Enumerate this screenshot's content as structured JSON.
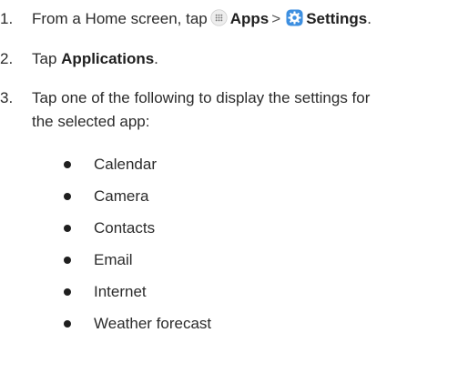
{
  "steps": [
    {
      "number": "1.",
      "prefix": "From a Home screen, tap",
      "apps_label": "Apps",
      "separator": ">",
      "settings_label": "Settings",
      "suffix": ".",
      "apps_icon": "apps-grid-icon",
      "settings_icon": "settings-gear-icon"
    },
    {
      "number": "2.",
      "prefix": "Tap",
      "bold": "Applications",
      "suffix": "."
    },
    {
      "number": "3.",
      "line1": "Tap one of the following to display the settings for",
      "line2": "the selected app:"
    }
  ],
  "apps": [
    "Calendar",
    "Camera",
    "Contacts",
    "Email",
    "Internet",
    "Weather forecast"
  ],
  "colors": {
    "text": "#2b2b2b",
    "settings_icon_bg": "#3d8fe0",
    "apps_icon_bg": "#eeeeee"
  }
}
